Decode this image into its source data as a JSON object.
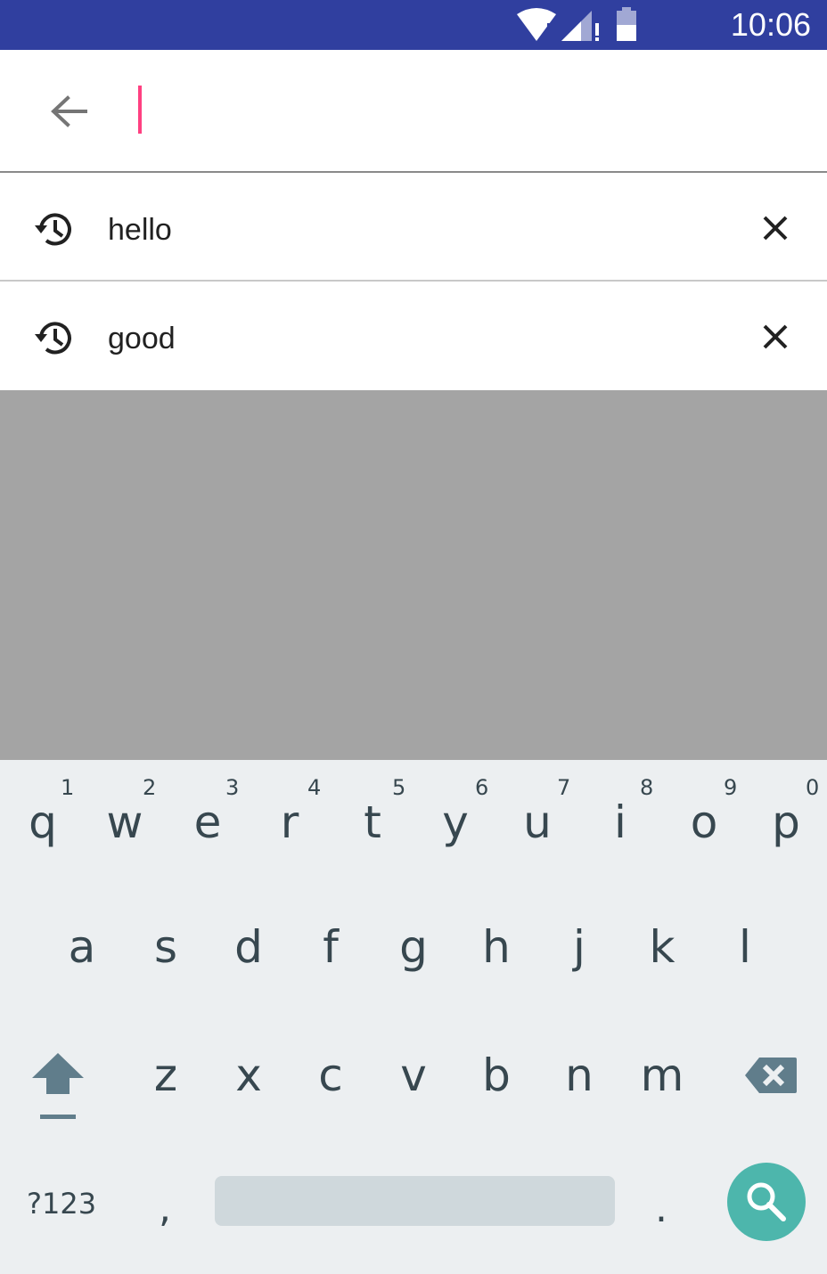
{
  "status_bar": {
    "time": "10:06",
    "icons": [
      "wifi-icon",
      "signal-icon",
      "battery-icon"
    ],
    "color": "#303f9f"
  },
  "search": {
    "value": "",
    "placeholder": "",
    "back_icon": "arrow-back-icon",
    "cursor_color": "#ff4081"
  },
  "suggestions": [
    {
      "text": "hello",
      "icon": "history-icon",
      "action_icon": "close-icon"
    },
    {
      "text": "good",
      "icon": "history-icon",
      "action_icon": "close-icon"
    }
  ],
  "keyboard": {
    "row1": [
      {
        "char": "q",
        "hint": "1"
      },
      {
        "char": "w",
        "hint": "2"
      },
      {
        "char": "e",
        "hint": "3"
      },
      {
        "char": "r",
        "hint": "4"
      },
      {
        "char": "t",
        "hint": "5"
      },
      {
        "char": "y",
        "hint": "6"
      },
      {
        "char": "u",
        "hint": "7"
      },
      {
        "char": "i",
        "hint": "8"
      },
      {
        "char": "o",
        "hint": "9"
      },
      {
        "char": "p",
        "hint": "0"
      }
    ],
    "row2": [
      "a",
      "s",
      "d",
      "f",
      "g",
      "h",
      "j",
      "k",
      "l"
    ],
    "row3": [
      "z",
      "x",
      "c",
      "v",
      "b",
      "n",
      "m"
    ],
    "row4": {
      "symbols_label": "?123",
      "comma": ",",
      "period": "."
    },
    "shift_icon": "shift-icon",
    "backspace_icon": "backspace-icon",
    "search_icon": "search-icon",
    "search_key_color": "#4db6ac",
    "background": "#eceff1"
  }
}
